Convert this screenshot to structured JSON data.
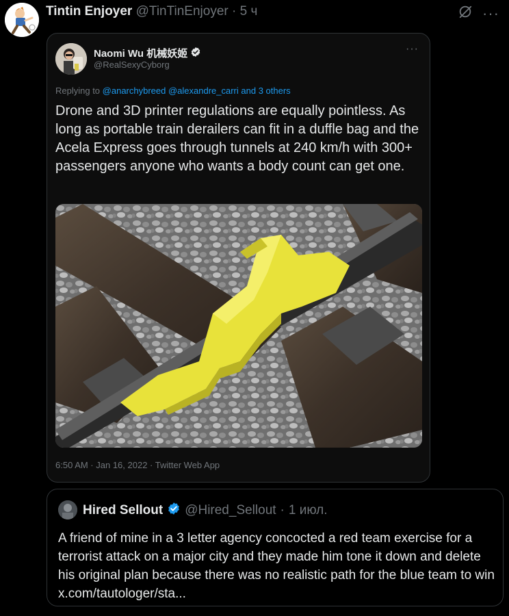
{
  "post": {
    "author_name": "Tintin Enjoyer",
    "author_handle": "@TinTinEnjoyer",
    "separator": "·",
    "time": "5 ч",
    "icons": [
      "grok-icon",
      "more-options-icon"
    ]
  },
  "quoted": {
    "author_name": "Naomi Wu 机械妖姬",
    "author_handle": "@RealSexyCyborg",
    "verified": true,
    "reply_prefix": "Replying to",
    "reply_mentions": "@anarchybreed @alexandre_carri",
    "reply_suffix": "and 3 others",
    "text": "Drone and 3D printer regulations are equally pointless. As long as portable train derailers can fit in a duffle bag and the Acela Express goes through tunnels at 240 km/h with 300+ passengers anyone who wants a body count can get one.",
    "image_alt": "yellow portable train derailer clamped on a rail",
    "meta": "6:50 AM · Jan 16, 2022 · Twitter Web App"
  },
  "reply": {
    "author_name": "Hired Sellout",
    "author_handle": "@Hired_Sellout",
    "separator": "·",
    "time": "1 июл.",
    "verified": true,
    "text": "A friend of mine in a 3 letter agency concocted a red team exercise for a terrorist attack on a major city and they made him tone it down and delete his original plan because there was no realistic path for the blue team to win x.com/tautologer/sta..."
  },
  "colors": {
    "background": "#000000",
    "text": "#e7e9ea",
    "muted": "#71767b",
    "link": "#1d9bf0",
    "verified": "#1d9bf0",
    "border": "#2f3336",
    "derailer_yellow": "#e8e23a"
  }
}
